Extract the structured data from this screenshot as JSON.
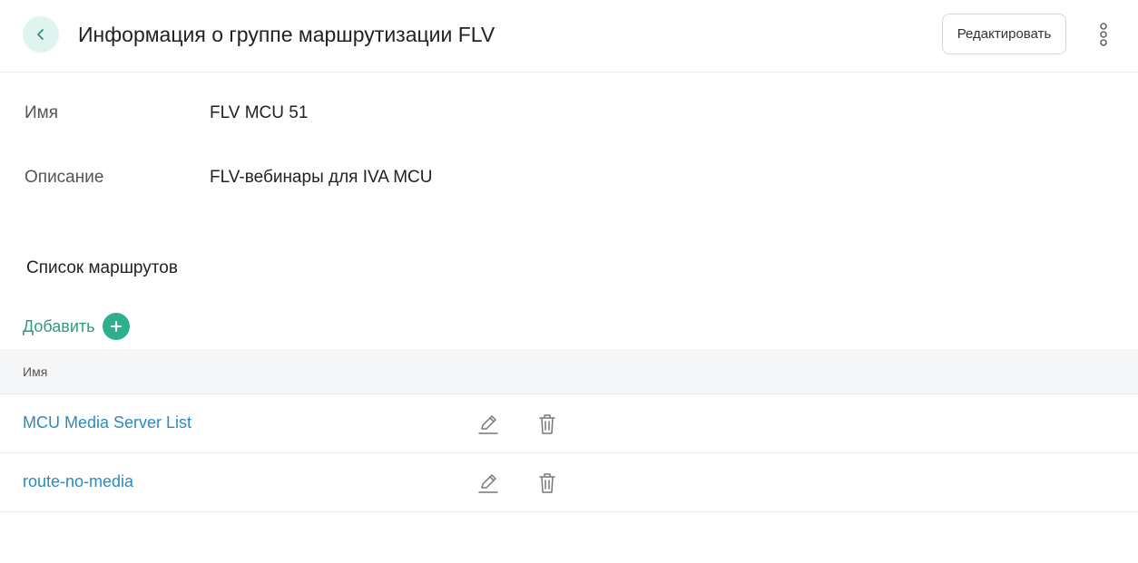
{
  "header": {
    "title": "Информация о группе маршрутизации FLV",
    "edit_label": "Редактировать",
    "back_icon": "chevron-left-icon",
    "more_icon": "more-vertical-icon"
  },
  "details": {
    "name_label": "Имя",
    "name_value": "FLV MCU 51",
    "description_label": "Описание",
    "description_value": "FLV-вебинары для IVA MCU"
  },
  "routes": {
    "title": "Список маршрутов",
    "add_label": "Добавить",
    "column_name": "Имя",
    "rows": [
      {
        "name": "MCU Media Server List"
      },
      {
        "name": "route-no-media"
      }
    ]
  },
  "colors": {
    "accent": "#2eb08f",
    "link": "#2d8ac0",
    "back_bg": "#e0f4ef"
  }
}
